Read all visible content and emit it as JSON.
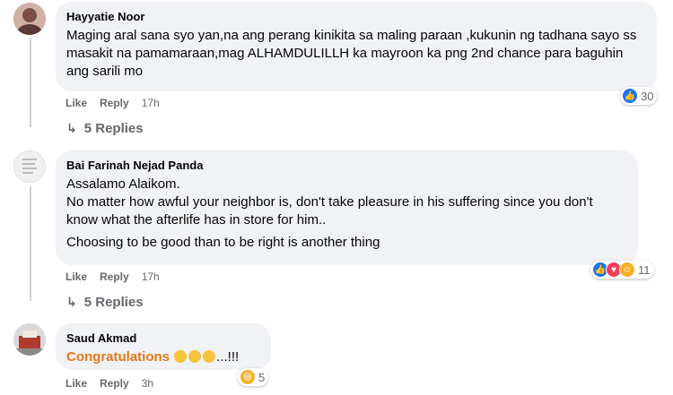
{
  "comments": [
    {
      "author": "Hayyatie Noor",
      "paragraphs": [
        "Maging aral sana syo yan,na ang perang kinikita sa maling paraan ,kukunin ng tadhana sayo ss masakit na pamamaraan,mag ALHAMDULILLH ka mayroon ka png 2nd chance para baguhin ang sarili mo"
      ],
      "like_label": "Like",
      "reply_label": "Reply",
      "time": "17h",
      "reaction_count": "30",
      "reaction_icons": [
        "like-icon"
      ],
      "replies_label": "5 Replies"
    },
    {
      "author": "Bai Farinah Nejad Panda",
      "paragraphs": [
        "Assalamo Alaikom.\nNo matter how awful your neighbor is, don't take pleasure in his suffering since you don't know what the afterlife has in store for him..",
        "Choosing to be good than to be right is another thing"
      ],
      "like_label": "Like",
      "reply_label": "Reply",
      "time": "17h",
      "reaction_count": "11",
      "reaction_icons": [
        "like-icon",
        "love-icon",
        "care-icon"
      ],
      "replies_label": "5 Replies"
    },
    {
      "author": "Saud Akmad",
      "text_highlight": "Congratulations",
      "text_rest": "...!!!",
      "like_label": "Like",
      "reply_label": "Reply",
      "time": "3h",
      "reaction_count": "5",
      "reaction_icons": [
        "haha-icon"
      ]
    }
  ],
  "colors": {
    "bubble": "#f0f2f5",
    "meta_text": "#65676b",
    "like_blue": "#1877f2",
    "love_red": "#f33e58",
    "care_yellow": "#f7b125",
    "highlight_orange": "#e4781b"
  }
}
